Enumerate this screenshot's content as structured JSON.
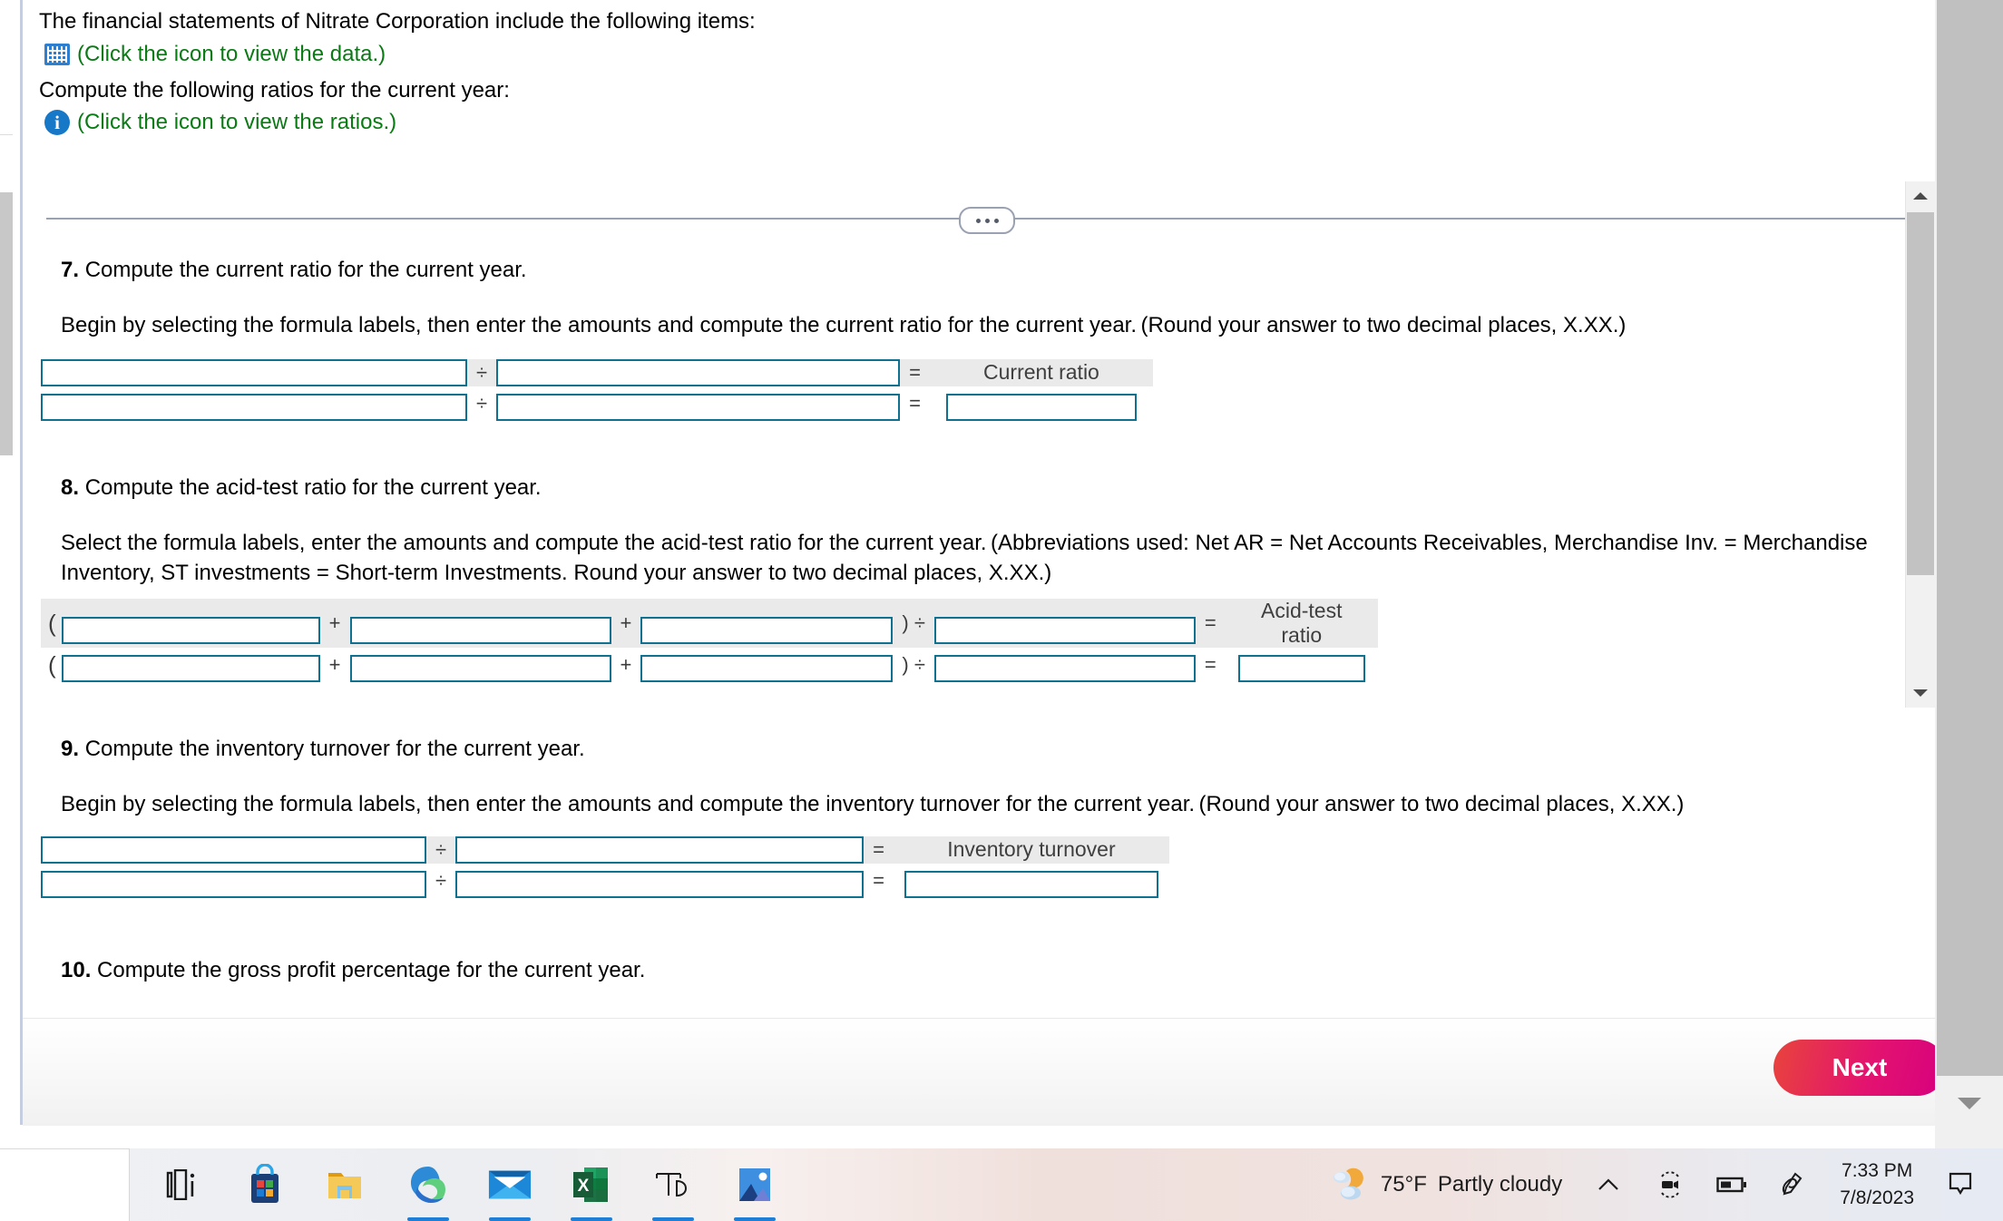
{
  "intro": {
    "statement": "The financial statements of Nitrate Corporation include the following items:",
    "data_link": "(Click the icon to view the data.)",
    "data_icon": "grid-table-icon",
    "compute_prompt": "Compute the following ratios for the current year:",
    "ratios_link": "(Click the icon to view the ratios.)",
    "ratios_icon": "info-circle-icon"
  },
  "divider": {
    "more_label": "more-options-dots"
  },
  "questions": [
    {
      "number": "7.",
      "title": "Compute the current ratio for the current year.",
      "desc_black": "Begin by selecting the formula labels, then enter the amounts and compute the current ratio for the current year.",
      "desc_green": "(Round your answer to two decimal places, X.XX.)",
      "result_label": "Current ratio",
      "operators": {
        "divide": "÷",
        "equals": "="
      }
    },
    {
      "number": "8.",
      "title": "Compute the acid-test ratio for the current year.",
      "desc_black": "Select the formula labels, enter the amounts and compute the acid-test ratio for the current year.",
      "desc_green": "(Abbreviations used: Net AR = Net Accounts Receivables, Merchandise Inv. = Merchandise Inventory, ST investments = Short-term Investments. Round your answer to two decimal places, X.XX.)",
      "result_label_line1": "Acid-test",
      "result_label_line2": "ratio",
      "operators": {
        "open_paren": "(",
        "plus": "+",
        "close_divide": ") ÷",
        "equals": "="
      }
    },
    {
      "number": "9.",
      "title": "Compute the inventory turnover for the current year.",
      "desc_black": "Begin by selecting the formula labels, then enter the amounts and compute the inventory turnover for the current year.",
      "desc_green": "(Round your answer to two decimal places, X.XX.)",
      "result_label": "Inventory turnover",
      "operators": {
        "divide": "÷",
        "equals": "="
      }
    },
    {
      "number": "10.",
      "title": "Compute the gross profit percentage for the current year."
    }
  ],
  "inputs": {
    "value": "",
    "placeholder": ""
  },
  "footer": {
    "next_label": "Next"
  },
  "scrollbars": {
    "inner_up": "scroll-up-arrow",
    "inner_down": "scroll-down-arrow",
    "outer_down": "page-scroll-down-arrow"
  },
  "taskbar": {
    "icons": [
      {
        "name": "task-view-icon",
        "active": false
      },
      {
        "name": "microsoft-store-icon",
        "active": false
      },
      {
        "name": "file-explorer-icon",
        "active": false
      },
      {
        "name": "microsoft-edge-icon",
        "active": true
      },
      {
        "name": "mail-icon",
        "active": true
      },
      {
        "name": "excel-icon",
        "active": true
      },
      {
        "name": "thesaurus-icon",
        "active": true
      },
      {
        "name": "photos-icon",
        "active": true
      }
    ],
    "weather": {
      "temperature": "75°F",
      "condition": "Partly cloudy"
    },
    "tray": [
      {
        "name": "show-hidden-icons-chevron"
      },
      {
        "name": "webcam-icon"
      },
      {
        "name": "battery-icon"
      },
      {
        "name": "pen-icon"
      }
    ],
    "clock": {
      "time": "7:33 PM",
      "date": "7/8/2023"
    },
    "notification": "notification-bell-icon"
  },
  "colors": {
    "input_border": "#10708f",
    "green_text": "#0a7a14",
    "highlight_row": "#eaeaea",
    "next_gradient_start": "#e8443c",
    "next_gradient_end": "#d6007f"
  }
}
